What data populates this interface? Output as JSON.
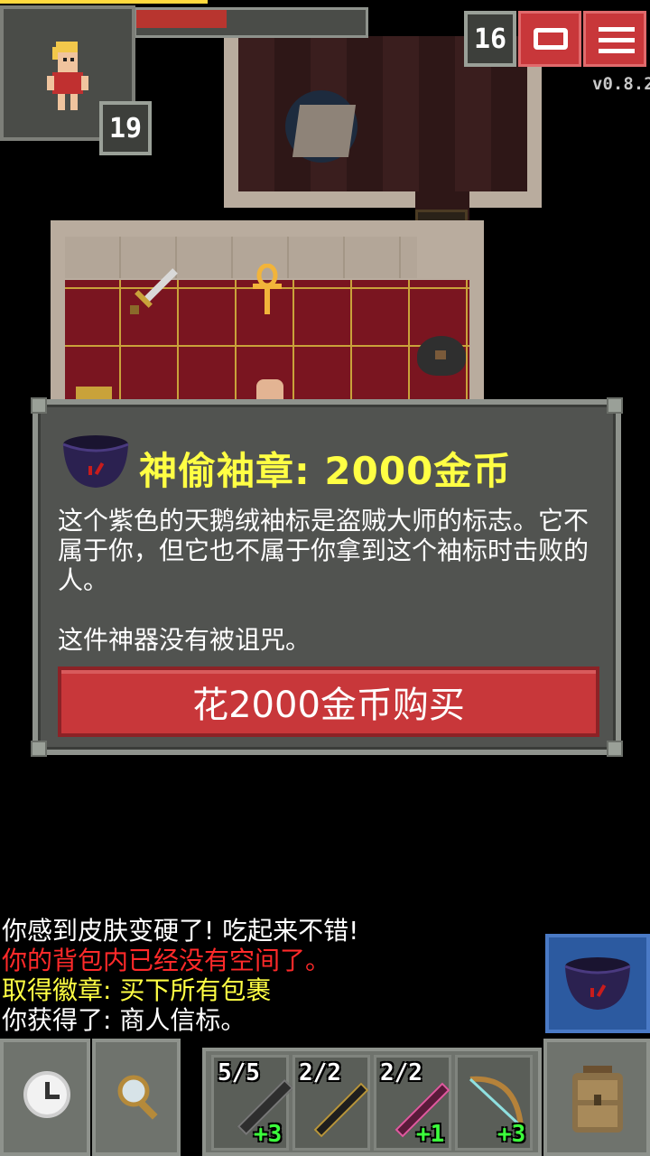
{
  "hud": {
    "hero_level": "19",
    "depth": "16",
    "version": "v0.8.2"
  },
  "dialog": {
    "title": "神偷袖章: 2000金币",
    "description": "这个紫色的天鹅绒袖标是盗贼大师的标志。它不属于你，但它也不属于你拿到这个袖标时击败的人。",
    "curse_note": "这件神器没有被诅咒。",
    "buy_label": "花2000金币购买"
  },
  "log": [
    {
      "text": "你感到皮肤变硬了!  吃起来不错!",
      "color": "#ffffff"
    },
    {
      "text": "你的背包内已经没有空间了。",
      "color": "#ff2a2a"
    },
    {
      "text": "取得徽章: 买下所有包裹",
      "color": "#ffff44"
    },
    {
      "text": "你获得了: 商人信标。",
      "color": "#ffffff"
    }
  ],
  "quickslots": [
    {
      "charges": "5/5",
      "bonus": "+3",
      "icon": "dark-wand-icon"
    },
    {
      "charges": "2/2",
      "bonus": "",
      "icon": "gold-wand-icon"
    },
    {
      "charges": "2/2",
      "bonus": "+1",
      "icon": "pink-wand-icon"
    },
    {
      "charges": "",
      "bonus": "+3",
      "icon": "bow-icon"
    }
  ],
  "colors": {
    "title_yellow": "#ffff44",
    "buy_red": "#c8373a",
    "log_red": "#ff2a2a"
  }
}
